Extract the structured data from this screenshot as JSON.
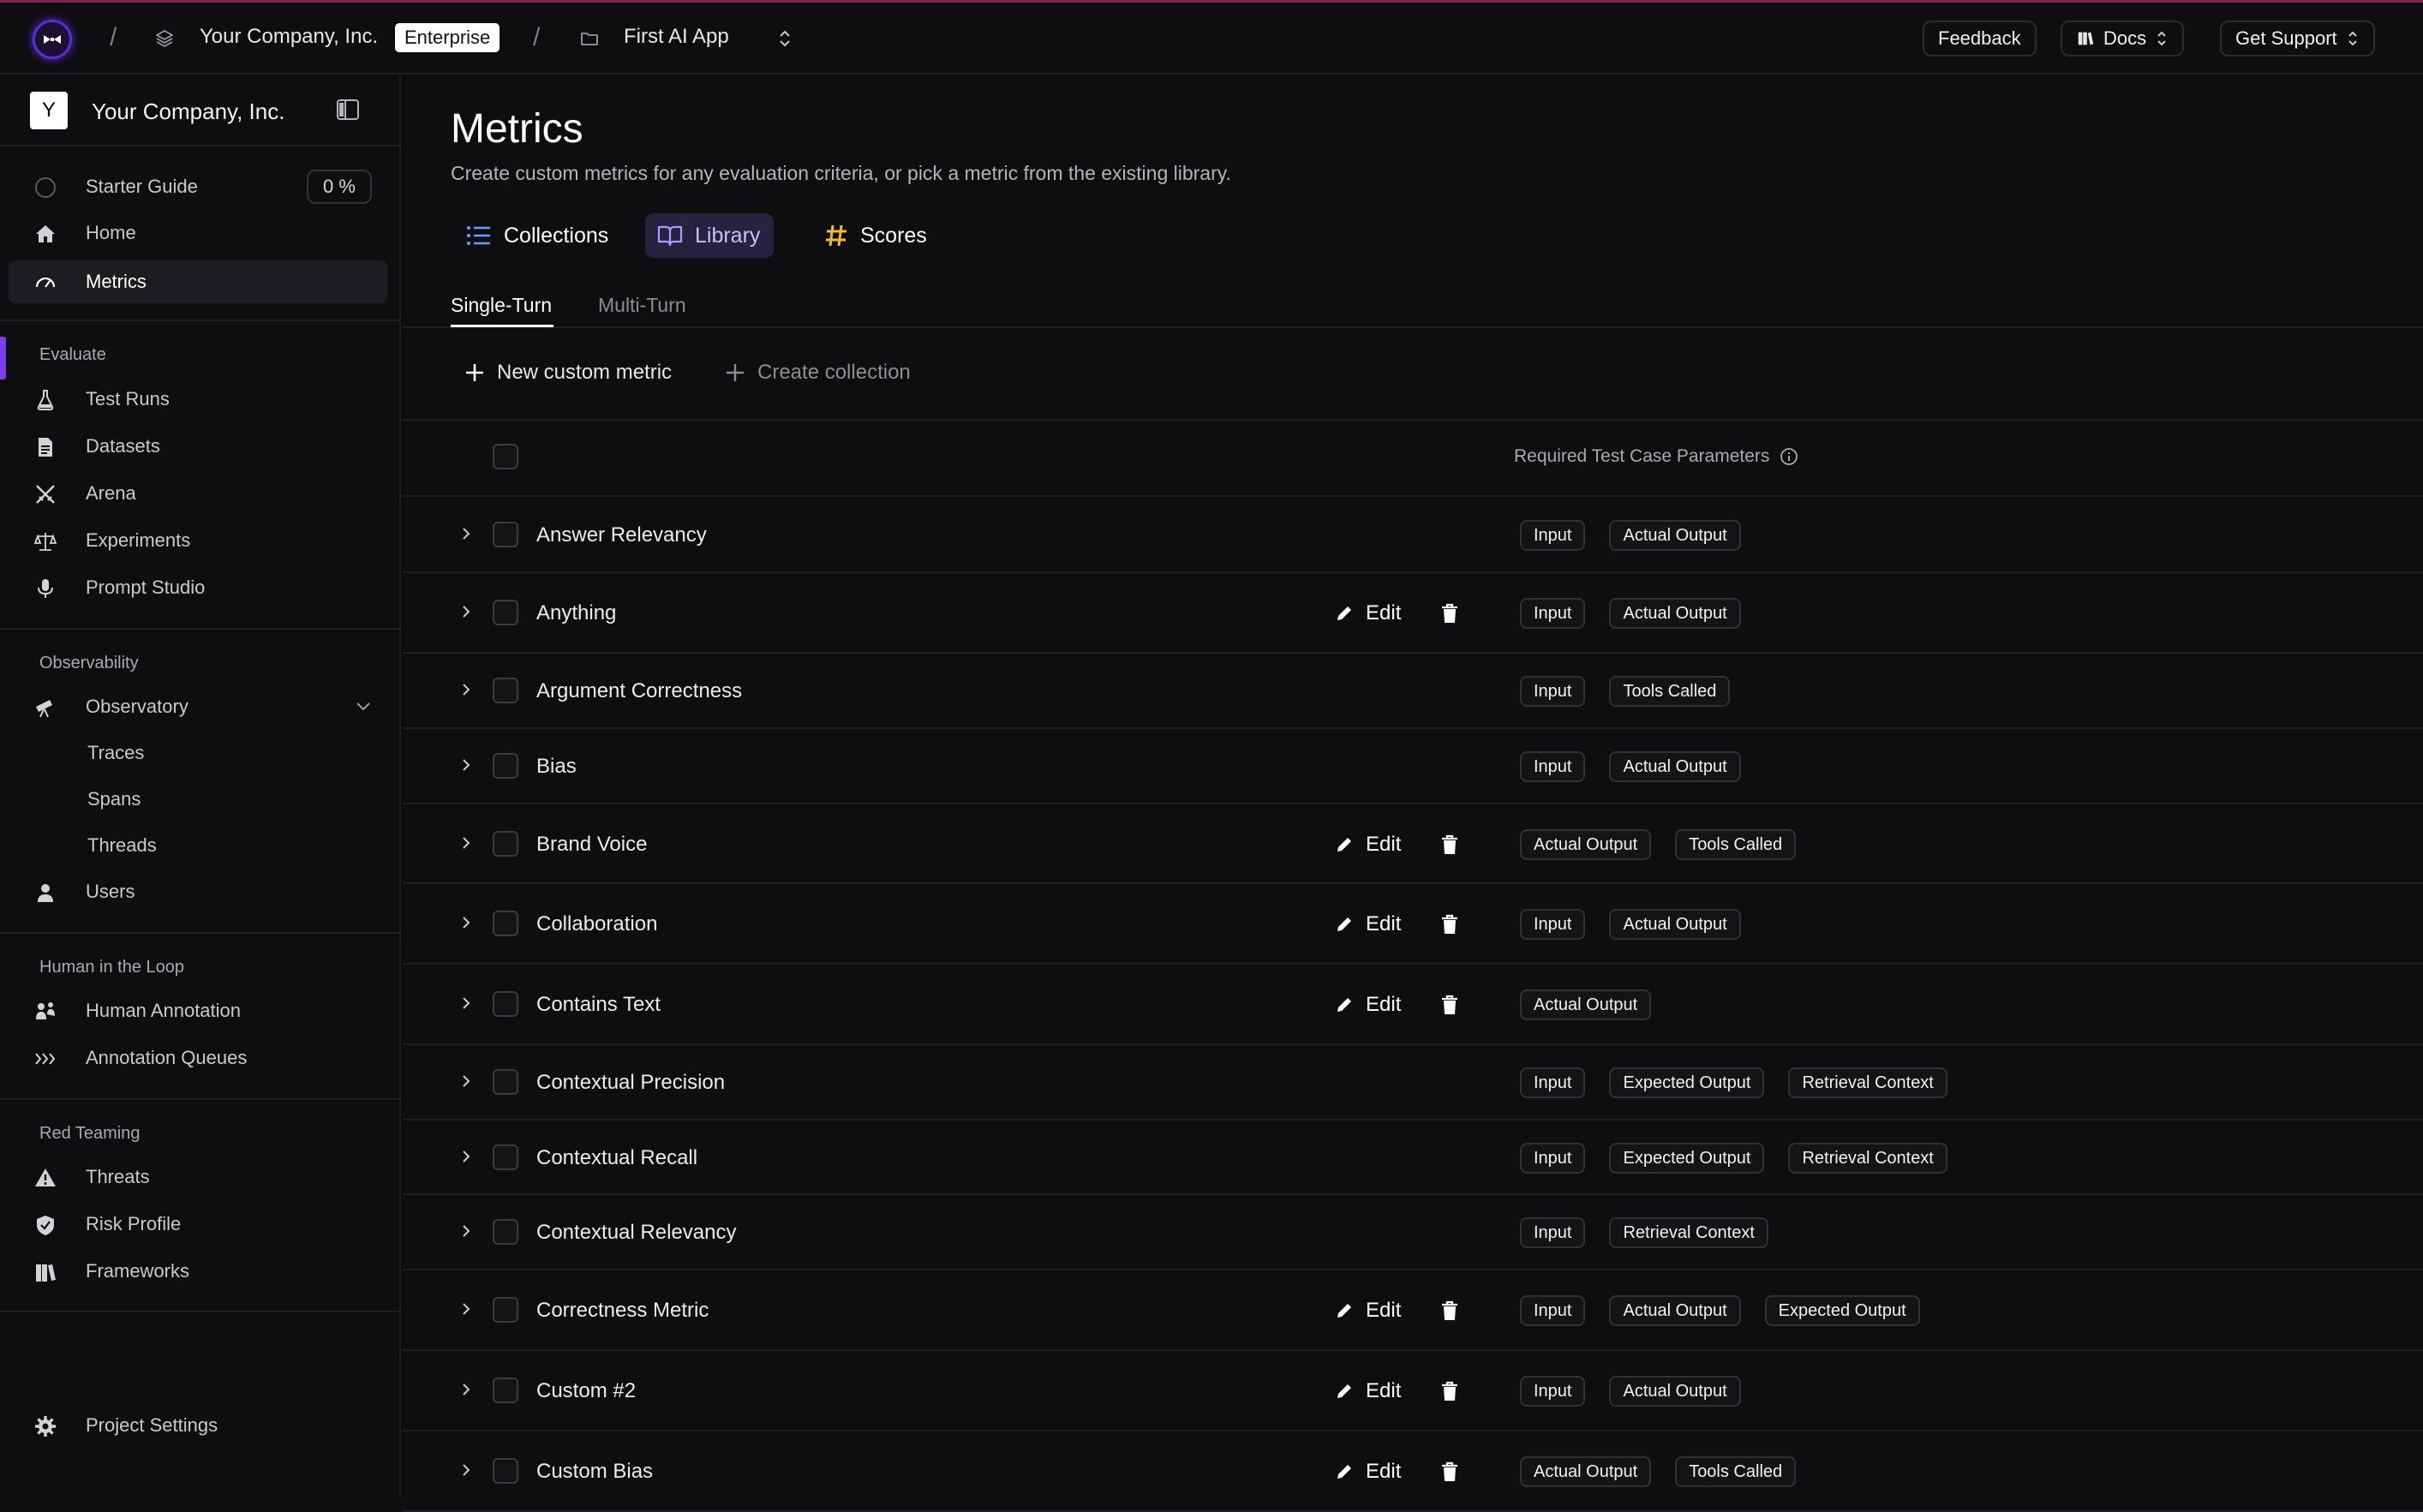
{
  "colors": {
    "accent": "#7b3df0",
    "background": "#0e0e10",
    "brand_line": "#8a1f52",
    "scores_icon": "#f5b731",
    "collections_icon": "#6f9bff"
  },
  "topbar": {
    "org_name": "Your Company, Inc.",
    "plan_badge": "Enterprise",
    "project_name": "First AI App",
    "feedback_label": "Feedback",
    "docs_label": "Docs",
    "support_label": "Get Support"
  },
  "sidebar": {
    "workspace_initial": "Y",
    "workspace_name": "Your Company, Inc.",
    "starter_guide": {
      "label": "Starter Guide",
      "percent": "0 %"
    },
    "home": "Home",
    "metrics": "Metrics",
    "sections": {
      "evaluate": {
        "title": "Evaluate",
        "items": [
          "Test Runs",
          "Datasets",
          "Arena",
          "Experiments",
          "Prompt Studio"
        ]
      },
      "observability": {
        "title": "Observability",
        "items": [
          "Observatory",
          "Traces",
          "Spans",
          "Threads",
          "Users"
        ]
      },
      "human": {
        "title": "Human in the Loop",
        "items": [
          "Human Annotation",
          "Annotation Queues"
        ]
      },
      "red": {
        "title": "Red Teaming",
        "items": [
          "Threats",
          "Risk Profile",
          "Frameworks"
        ]
      }
    },
    "settings": "Project Settings"
  },
  "main": {
    "title": "Metrics",
    "subtitle": "Create custom metrics for any evaluation criteria, or pick a metric from the existing library.",
    "segments": [
      "Collections",
      "Library",
      "Scores"
    ],
    "tabs": [
      "Single-Turn",
      "Multi-Turn"
    ],
    "actions": {
      "new_metric": "New custom metric",
      "create_collection": "Create collection"
    },
    "table_header": "Required Test Case Parameters",
    "edit_label": "Edit",
    "rows": [
      {
        "name": "Answer Relevancy",
        "editable": false,
        "params": [
          "Input",
          "Actual Output"
        ]
      },
      {
        "name": "Anything",
        "editable": true,
        "params": [
          "Input",
          "Actual Output"
        ]
      },
      {
        "name": "Argument Correctness",
        "editable": false,
        "params": [
          "Input",
          "Tools Called"
        ]
      },
      {
        "name": "Bias",
        "editable": false,
        "params": [
          "Input",
          "Actual Output"
        ]
      },
      {
        "name": "Brand Voice",
        "editable": true,
        "params": [
          "Actual Output",
          "Tools Called"
        ]
      },
      {
        "name": "Collaboration",
        "editable": true,
        "params": [
          "Input",
          "Actual Output"
        ]
      },
      {
        "name": "Contains Text",
        "editable": true,
        "params": [
          "Actual Output"
        ]
      },
      {
        "name": "Contextual Precision",
        "editable": false,
        "params": [
          "Input",
          "Expected Output",
          "Retrieval Context"
        ]
      },
      {
        "name": "Contextual Recall",
        "editable": false,
        "params": [
          "Input",
          "Expected Output",
          "Retrieval Context"
        ]
      },
      {
        "name": "Contextual Relevancy",
        "editable": false,
        "params": [
          "Input",
          "Retrieval Context"
        ]
      },
      {
        "name": "Correctness Metric",
        "editable": true,
        "params": [
          "Input",
          "Actual Output",
          "Expected Output"
        ]
      },
      {
        "name": "Custom #2",
        "editable": true,
        "params": [
          "Input",
          "Actual Output"
        ]
      },
      {
        "name": "Custom Bias",
        "editable": true,
        "params": [
          "Actual Output",
          "Tools Called"
        ]
      }
    ]
  }
}
